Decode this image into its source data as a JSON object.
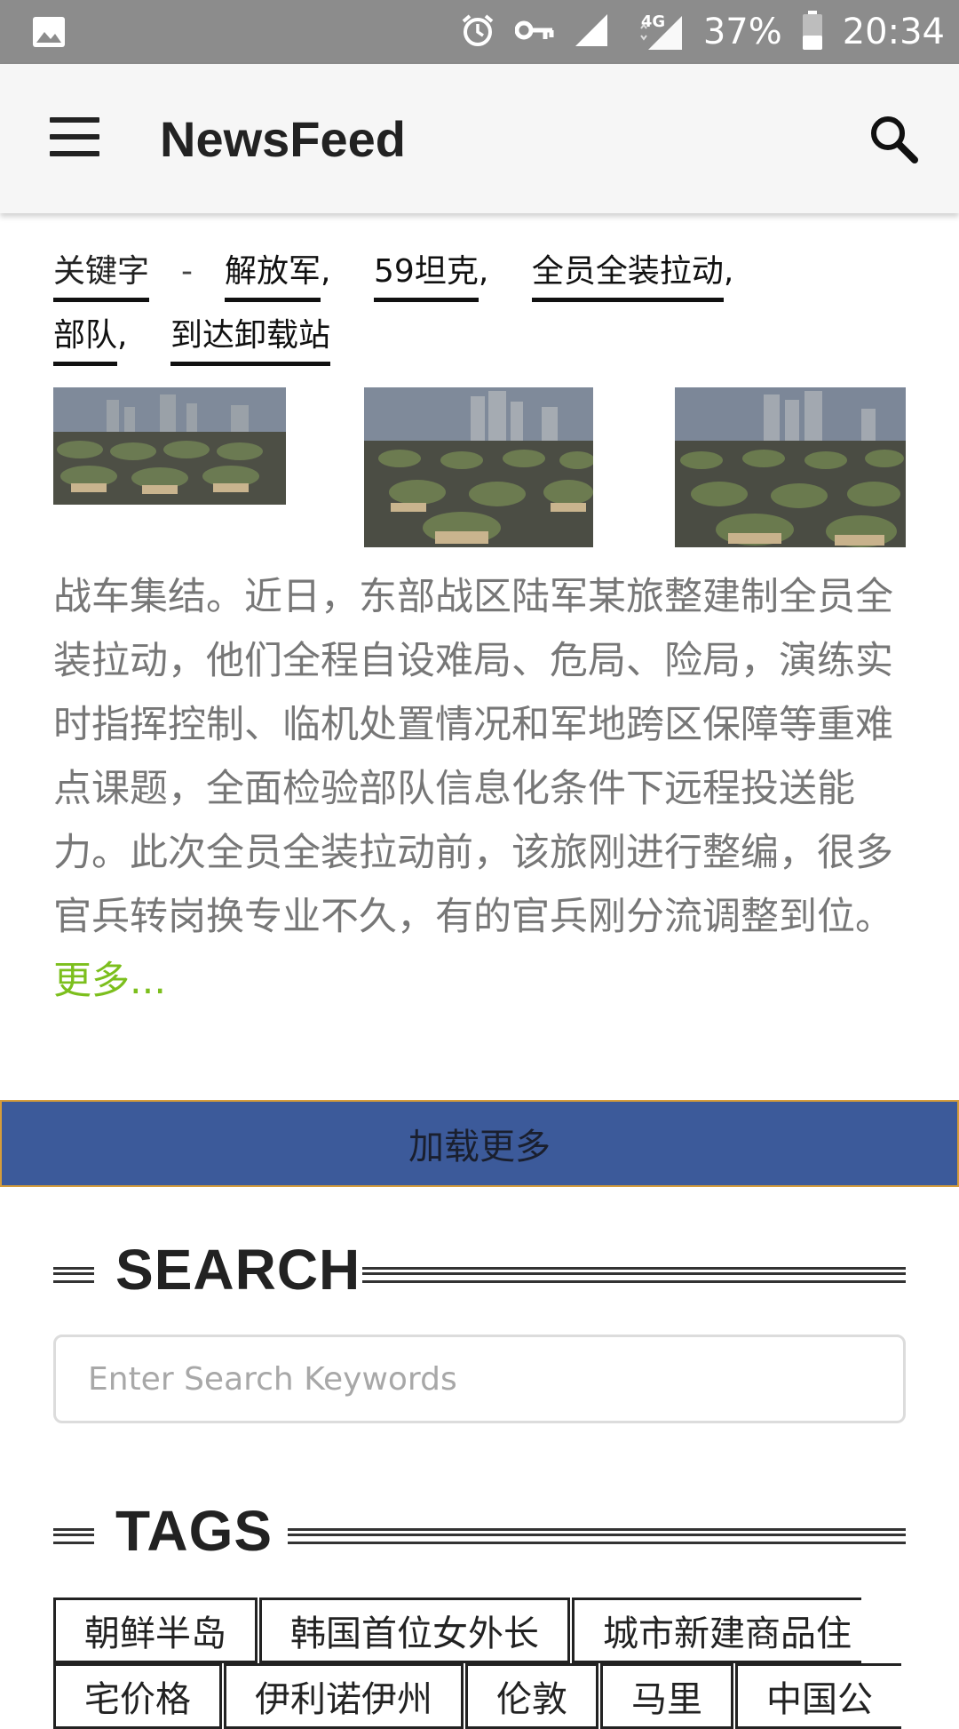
{
  "status_bar": {
    "battery": "37%",
    "time": "20:34",
    "network": "4G"
  },
  "app_bar": {
    "title": "NewsFeed"
  },
  "article": {
    "keywords_label": "关键字",
    "keywords_dash": "-",
    "keywords": [
      "解放军",
      "59坦克",
      "全员全装拉动",
      "部队",
      "到达卸载站"
    ],
    "body": "战车集结。近日，东部战区陆军某旅整建制全员全装拉动，他们全程自设难局、危局、险局，演练实时指挥控制、临机处置情况和军地跨区保障等重难点课题，全面检验部队信息化条件下远程投送能力。此次全员全装拉动前，该旅刚进行整编，很多官兵转岗换专业不久，有的官兵刚分流调整到位。",
    "more_label": "更多..."
  },
  "load_more": {
    "label": "加载更多"
  },
  "search_section": {
    "title": "SEARCH",
    "placeholder": "Enter Search Keywords"
  },
  "tags_section": {
    "title": "TAGS",
    "row1": [
      "朝鲜半岛",
      "韩国首位女外长",
      "城市新建商品住"
    ],
    "row2": [
      "宅价格",
      "伊利诺伊州",
      "伦敦",
      "马里",
      "中国公"
    ]
  },
  "colors": {
    "status_bar": "#8c8c8c",
    "app_bar": "#f6f6f6",
    "load_more_bg": "#3c5a9a",
    "more_link": "#7cbf1d"
  }
}
